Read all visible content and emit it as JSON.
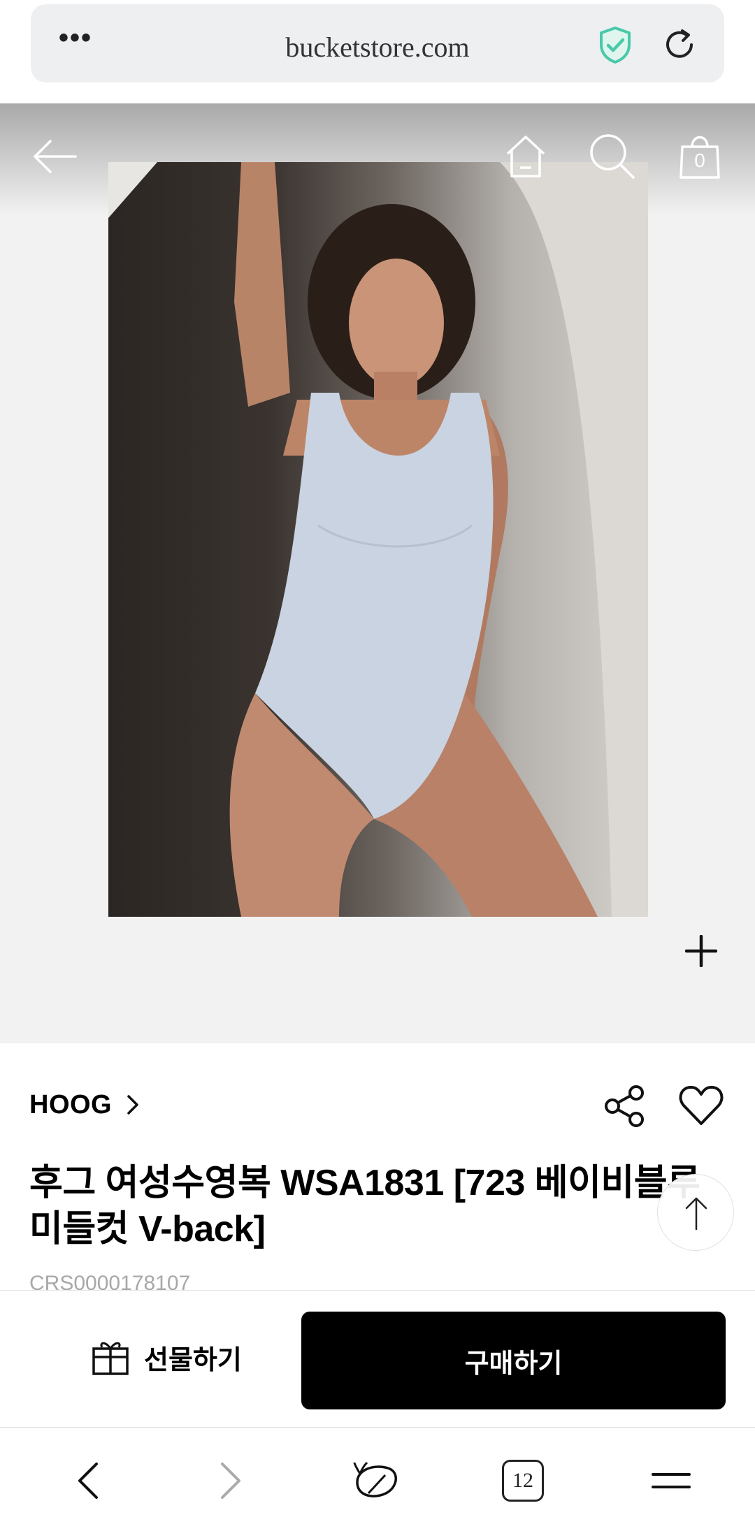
{
  "browser": {
    "url": "bucketstore.com",
    "menu_glyph": "•••",
    "tab_count": "12"
  },
  "header": {
    "cart_count": "0"
  },
  "product": {
    "brand": "HOOG",
    "title": "후그 여성수영복 WSA1831 [723 베이비블루 미들컷 V-back]",
    "code": "CRS0000178107"
  },
  "actions": {
    "gift_label": "선물하기",
    "buy_label": "구매하기"
  },
  "colors": {
    "accent_shield": "#48c9a9",
    "buy_button_bg": "#000000"
  }
}
